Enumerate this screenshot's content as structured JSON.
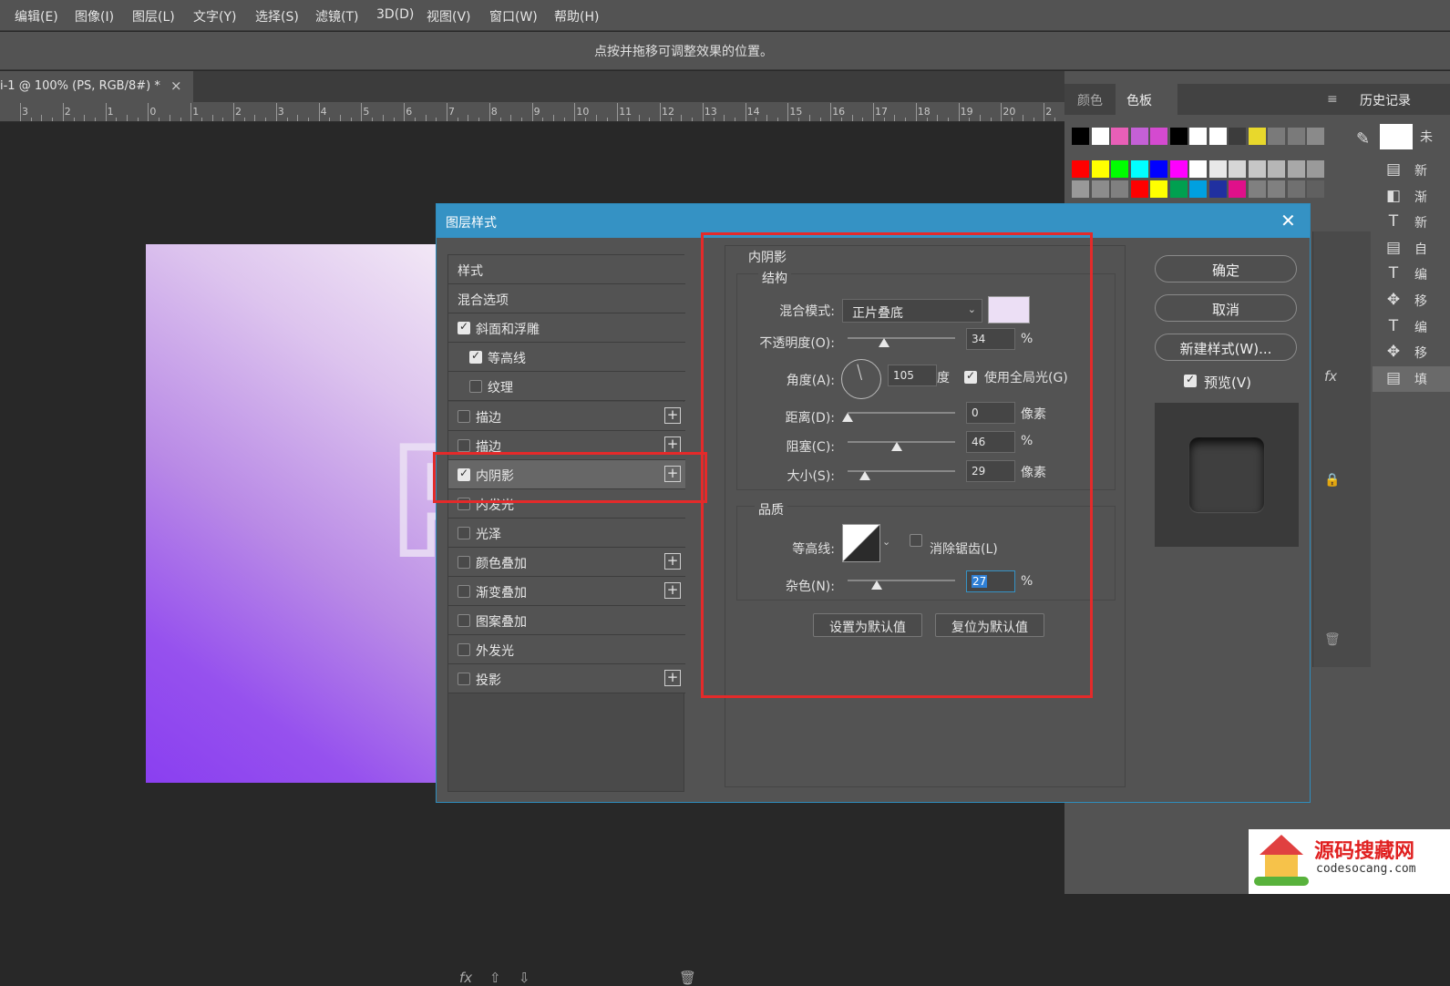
{
  "menu": [
    "编辑(E)",
    "图像(I)",
    "图层(L)",
    "文字(Y)",
    "选择(S)",
    "滤镜(T)",
    "3D(D)",
    "视图(V)",
    "窗口(W)",
    "帮助(H)"
  ],
  "options_hint": "点按并拖移可调整效果的位置。",
  "document_tab": {
    "title": "i-1 @ 100% (PS, RGB/8#) *",
    "close": "×"
  },
  "ruler_ticks": [
    "3",
    "2",
    "1",
    "0",
    "1",
    "2",
    "3",
    "4",
    "5",
    "6",
    "7",
    "8",
    "9",
    "10",
    "11",
    "12",
    "13",
    "14",
    "15",
    "16",
    "17",
    "18",
    "19",
    "20",
    "2"
  ],
  "swatch_panel": {
    "tabs": [
      "颜色",
      "色板"
    ],
    "active": "色板"
  },
  "swatch_colors": {
    "row1": [
      "#000000",
      "#ffffff",
      "#e85fb7",
      "#c460d6",
      "#d44ad0",
      "#000000",
      "#ffffff",
      "#ffffff",
      "#3c3c3c",
      "#e8d82c",
      "#7a7a7a",
      "#7a7a7a",
      "#8a8a8a"
    ],
    "row2": [
      "#ff0000",
      "#ffff00",
      "#00ff00",
      "#00ffff",
      "#0000ff",
      "#ff00ff",
      "#ffffff",
      "#e8e8e8",
      "#d6d6d6",
      "#c6c6c6",
      "#b6b6b6",
      "#a8a8a8",
      "#9a9a9a"
    ],
    "row3": [
      "#999999",
      "#8c8c8c",
      "#808080",
      "#ff0000",
      "#ffff00",
      "#00a050",
      "#00a0e0",
      "#2030a0",
      "#e0108a",
      "#808080",
      "#808080",
      "#707070",
      "#606060"
    ]
  },
  "history": {
    "title": "历史记录",
    "snapshot_label": "未",
    "items": [
      {
        "icon": "document-icon",
        "glyph": "▤",
        "label": "新"
      },
      {
        "icon": "gradient-icon",
        "glyph": "◧",
        "label": "渐"
      },
      {
        "icon": "type-icon",
        "glyph": "T",
        "label": "新"
      },
      {
        "icon": "document-icon",
        "glyph": "▤",
        "label": "自"
      },
      {
        "icon": "type-icon",
        "glyph": "T",
        "label": "编"
      },
      {
        "icon": "move-icon",
        "glyph": "✥",
        "label": "移"
      },
      {
        "icon": "type-icon",
        "glyph": "T",
        "label": "编"
      },
      {
        "icon": "move-icon",
        "glyph": "✥",
        "label": "移"
      },
      {
        "icon": "document-icon",
        "glyph": "▤",
        "label": "填"
      }
    ]
  },
  "layers_fragment": {
    "fx": "fx"
  },
  "dialog": {
    "title": "图层样式",
    "close": "✕",
    "styles": [
      {
        "label": "样式",
        "checkbox": null,
        "plus": false,
        "indent": 0
      },
      {
        "label": "混合选项",
        "checkbox": null,
        "plus": false,
        "indent": 0
      },
      {
        "label": "斜面和浮雕",
        "checkbox": true,
        "plus": false,
        "indent": 0
      },
      {
        "label": "等高线",
        "checkbox": true,
        "plus": false,
        "indent": 1
      },
      {
        "label": "纹理",
        "checkbox": false,
        "plus": false,
        "indent": 1
      },
      {
        "label": "描边",
        "checkbox": false,
        "plus": true,
        "indent": 0
      },
      {
        "label": "描边",
        "checkbox": false,
        "plus": true,
        "indent": 0
      },
      {
        "label": "内阴影",
        "checkbox": true,
        "plus": true,
        "indent": 0,
        "selected": true
      },
      {
        "label": "内发光",
        "checkbox": false,
        "plus": false,
        "indent": 0
      },
      {
        "label": "光泽",
        "checkbox": false,
        "plus": false,
        "indent": 0
      },
      {
        "label": "颜色叠加",
        "checkbox": false,
        "plus": true,
        "indent": 0
      },
      {
        "label": "渐变叠加",
        "checkbox": false,
        "plus": true,
        "indent": 0
      },
      {
        "label": "图案叠加",
        "checkbox": false,
        "plus": false,
        "indent": 0
      },
      {
        "label": "外发光",
        "checkbox": false,
        "plus": false,
        "indent": 0
      },
      {
        "label": "投影",
        "checkbox": false,
        "plus": true,
        "indent": 0
      }
    ],
    "footer_icons": {
      "fx": "fx",
      "up": "⇧",
      "down": "⇩",
      "trash": "🗑"
    },
    "section_title": "内阴影",
    "structure": {
      "title": "结构",
      "blend_mode_label": "混合模式:",
      "blend_mode_value": "正片叠底",
      "shadow_color": "#ecdff5",
      "opacity_label": "不透明度(O):",
      "opacity_value": "34",
      "opacity_unit": "%",
      "opacity_level": 34,
      "angle_label": "角度(A):",
      "angle_value": "105",
      "angle_unit": "度",
      "global_light_label": "使用全局光(G)",
      "global_light_checked": true,
      "distance_label": "距离(D):",
      "distance_value": "0",
      "distance_unit": "像素",
      "distance_level": 0,
      "choke_label": "阻塞(C):",
      "choke_value": "46",
      "choke_unit": "%",
      "choke_level": 46,
      "size_label": "大小(S):",
      "size_value": "29",
      "size_unit": "像素",
      "size_level": 16
    },
    "quality": {
      "title": "品质",
      "contour_label": "等高线:",
      "antialias_label": "消除锯齿(L)",
      "antialias_checked": false,
      "noise_label": "杂色(N):",
      "noise_value": "27",
      "noise_unit": "%",
      "noise_level": 27
    },
    "set_default": "设置为默认值",
    "reset_default": "复位为默认值",
    "ok": "确定",
    "cancel": "取消",
    "new_style": "新建样式(W)...",
    "preview_label": "预览(V)",
    "preview_checked": true
  },
  "watermark": {
    "title": "源码搜藏网",
    "url": "codesocang.com"
  }
}
